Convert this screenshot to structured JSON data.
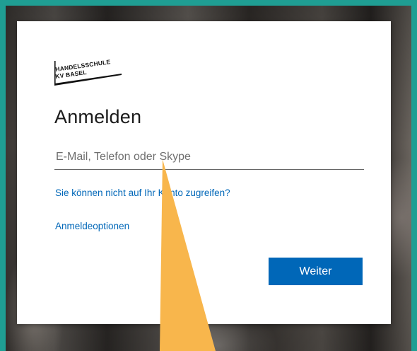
{
  "org": {
    "logo_line1": "HANDELSSCHULE",
    "logo_line2": "KV BASEL"
  },
  "signin": {
    "title": "Anmelden",
    "input_placeholder": "E-Mail, Telefon oder Skype",
    "input_value": "",
    "cant_access_link": "Sie können nicht auf Ihr Konto zugreifen?",
    "options_link": "Anmeldeoptionen",
    "next_button": "Weiter"
  },
  "colors": {
    "frame": "#1f9e93",
    "accent": "#0067b8",
    "pointer": "#f8b64c"
  }
}
